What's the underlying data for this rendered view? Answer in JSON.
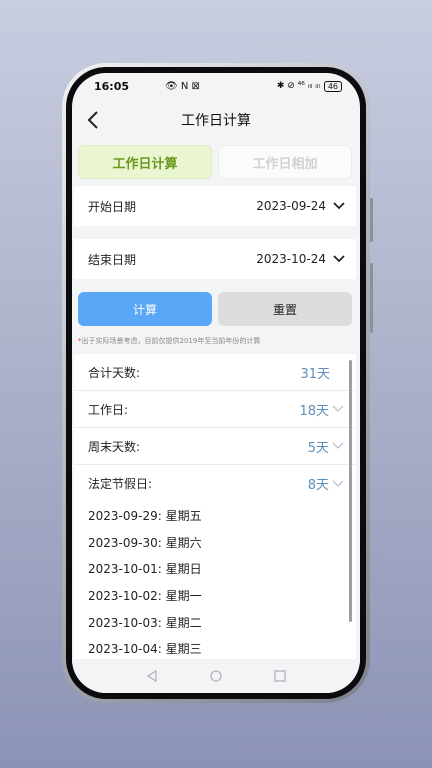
{
  "status": {
    "time": "16:05",
    "left_icons": "👁 N ⊠",
    "right_icons": "✱ ⊘ ⁴⁶ ᵢₗₗ ᵢₗₗ",
    "battery": "46"
  },
  "nav": {
    "title": "工作日计算"
  },
  "tabs": [
    {
      "label": "工作日计算",
      "active": true
    },
    {
      "label": "工作日相加",
      "active": false
    }
  ],
  "form": {
    "start": {
      "label": "开始日期",
      "value": "2023-09-24"
    },
    "end": {
      "label": "结束日期",
      "value": "2023-10-24"
    }
  },
  "buttons": {
    "calc": "计算",
    "reset": "重置"
  },
  "note": {
    "star": "*",
    "text": "出于实际场景考虑，目前仅提供2019年至当前年份的计算"
  },
  "result": {
    "total": {
      "label": "合计天数:",
      "value": "31天"
    },
    "workdays": {
      "label": "工作日:",
      "value": "18天"
    },
    "weekends": {
      "label": "周末天数:",
      "value": "5天"
    },
    "holidays": {
      "label": "法定节假日:",
      "value": "8天"
    },
    "holiday_list": [
      "2023-09-29:  星期五",
      "2023-09-30:  星期六",
      "2023-10-01:  星期日",
      "2023-10-02:  星期一",
      "2023-10-03:  星期二",
      "2023-10-04:  星期三"
    ]
  },
  "colors": {
    "accent_green": "#6a9a1c",
    "accent_blue": "#5aa7f7",
    "value_blue": "#5f8fb8"
  },
  "icons": {
    "back": "chevron-left-icon",
    "dropdown": "chevron-down-icon"
  }
}
